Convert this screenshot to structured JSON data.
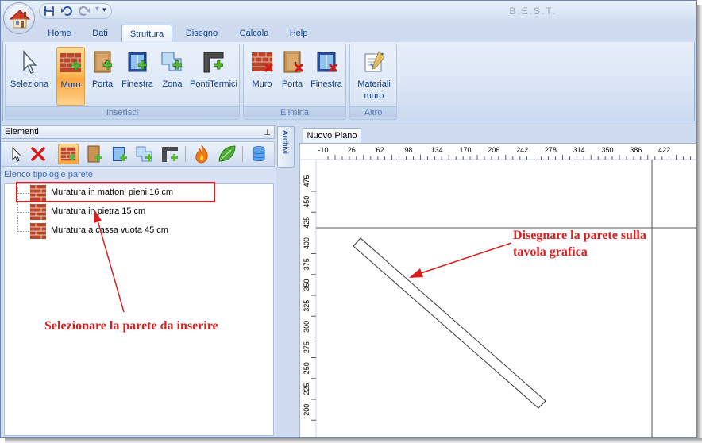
{
  "window": {
    "title": "B.E.S.T."
  },
  "quick_access": {
    "icons": [
      "save-icon",
      "undo-icon",
      "redo-icon",
      "customize-icon"
    ],
    "more": "▾"
  },
  "tabs": [
    {
      "label": "Home"
    },
    {
      "label": "Dati"
    },
    {
      "label": "Struttura",
      "active": true
    },
    {
      "label": "Disegno"
    },
    {
      "label": "Calcola"
    },
    {
      "label": "Help"
    }
  ],
  "ribbon": {
    "groups": [
      {
        "label": "Inserisci",
        "buttons": [
          {
            "label": "Seleziona",
            "icon": "cursor-icon"
          },
          {
            "label": "Muro",
            "icon": "brick-wall-add-icon",
            "selected": true
          },
          {
            "label": "Porta",
            "icon": "door-add-icon"
          },
          {
            "label": "Finestra",
            "icon": "window-add-icon"
          },
          {
            "label": "Zona",
            "icon": "zone-add-icon"
          },
          {
            "label": "PontiTermici",
            "icon": "thermal-bridge-add-icon"
          }
        ]
      },
      {
        "label": "Elimina",
        "buttons": [
          {
            "label": "Muro",
            "icon": "brick-wall-delete-icon"
          },
          {
            "label": "Porta",
            "icon": "door-delete-icon"
          },
          {
            "label": "Finestra",
            "icon": "window-delete-icon"
          }
        ]
      },
      {
        "label": "Altro",
        "buttons": [
          {
            "label": "Materiali\nmuro",
            "line1": "Materiali",
            "line2": "muro",
            "icon": "materials-edit-icon"
          }
        ]
      }
    ]
  },
  "elements_panel": {
    "title": "Elementi",
    "pin": "📌",
    "toolbar_icons": [
      "cursor-icon",
      "delete-icon",
      "brick-wall-icon",
      "door-icon",
      "window-icon",
      "zone-icon",
      "thermal-bridge-icon",
      "fire-icon",
      "leaf-icon",
      "database-icon"
    ],
    "list_header": "Elenco tipologie parete",
    "items": [
      {
        "label": "Muratura in mattoni pieni 16 cm"
      },
      {
        "label": "Muratura in pietra 15 cm"
      },
      {
        "label": "Muratura a cassa vuota 45 cm"
      }
    ]
  },
  "archivi_tab": "Archivi",
  "drawing": {
    "tab_label": "Nuovo Piano",
    "x_ticks": [
      "-10",
      "26",
      "62",
      "98",
      "134",
      "170",
      "206",
      "242",
      "278",
      "314",
      "350",
      "386",
      "422"
    ],
    "y_ticks": [
      "475",
      "450",
      "425",
      "400",
      "375",
      "350",
      "325",
      "300",
      "275",
      "250",
      "225",
      "200"
    ]
  },
  "annotations": {
    "left": "Selezionare la parete da inserire",
    "right_line1": "Disegnare la parete sulla",
    "right_line2": "tavola grafica",
    "color": "#d62020"
  }
}
